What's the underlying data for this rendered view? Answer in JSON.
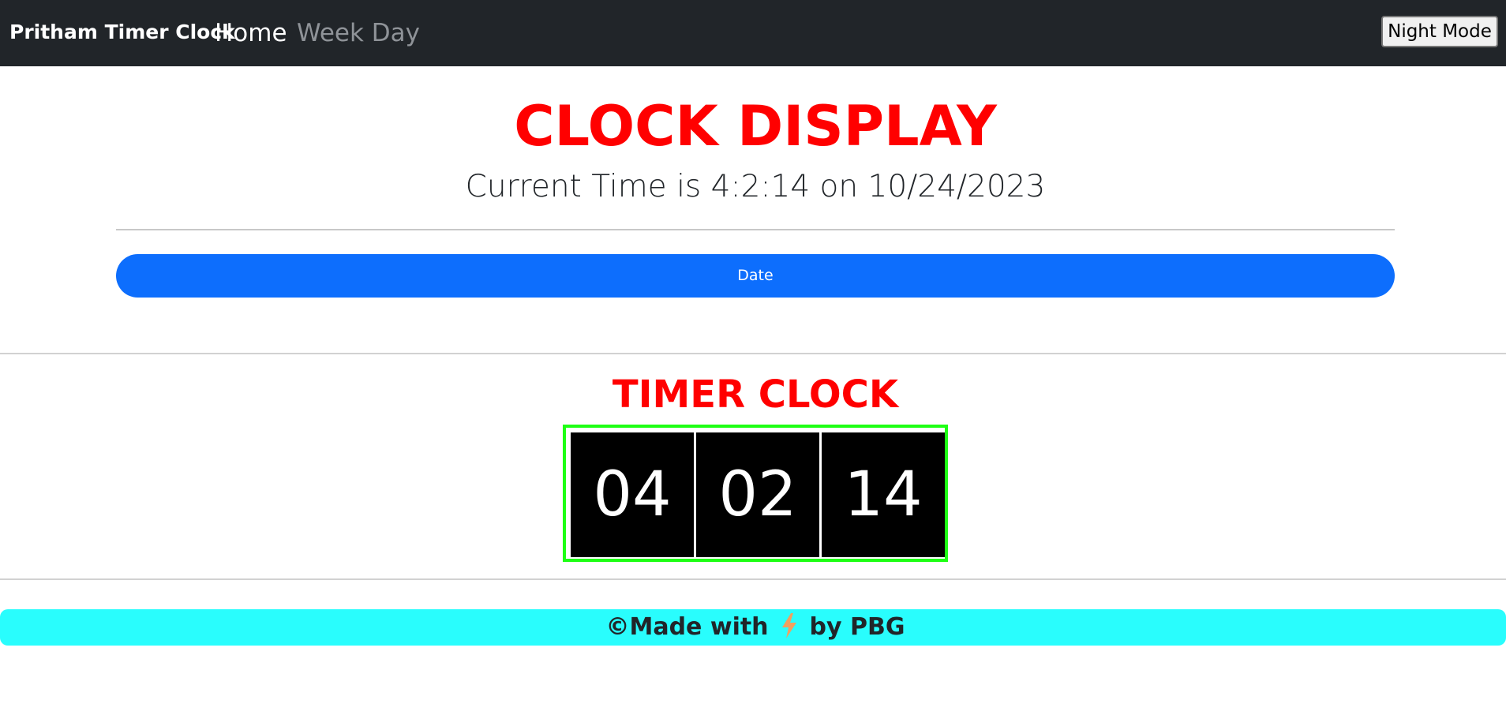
{
  "navbar": {
    "brand": "Pritham Timer Clock",
    "links": [
      "Home",
      "Week Day"
    ],
    "night_mode_label": "Night Mode"
  },
  "clock_display": {
    "title": "CLOCK DISPLAY",
    "current_time_text": "Current Time is 4:2:14 on 10/24/2023",
    "date_button_label": "Date"
  },
  "timer_clock": {
    "title": "TIMER CLOCK",
    "hours": "04",
    "minutes": "02",
    "seconds": "14"
  },
  "footer": {
    "prefix": "©Made with",
    "icon": "lightning-bolt-icon",
    "suffix": "by PBG"
  },
  "colors": {
    "navbar_bg": "#212529",
    "title_red": "#ff0000",
    "date_button_blue": "#0d6efd",
    "timer_border_green": "#1eff14",
    "footer_cyan": "#29fdfd",
    "bolt_orange": "#f0a060"
  }
}
